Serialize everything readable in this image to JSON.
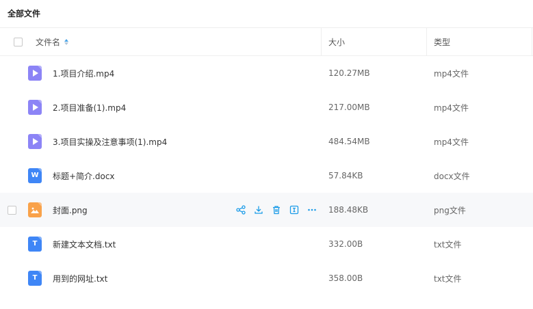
{
  "page": {
    "title": "全部文件"
  },
  "table": {
    "columns": {
      "name": "文件名",
      "size": "大小",
      "type": "类型"
    },
    "rows": [
      {
        "name": "1.项目介绍.mp4",
        "size": "120.27MB",
        "type": "mp4文件",
        "icon": "video-file-icon"
      },
      {
        "name": "2.项目准备(1).mp4",
        "size": "217.00MB",
        "type": "mp4文件",
        "icon": "video-file-icon"
      },
      {
        "name": "3.项目实操及注意事项(1).mp4",
        "size": "484.54MB",
        "type": "mp4文件",
        "icon": "video-file-icon"
      },
      {
        "name": "标题+简介.docx",
        "size": "57.84KB",
        "type": "docx文件",
        "icon": "word-file-icon"
      },
      {
        "name": "封面.png",
        "size": "188.48KB",
        "type": "png文件",
        "icon": "image-file-icon"
      },
      {
        "name": "新建文本文档.txt",
        "size": "332.00B",
        "type": "txt文件",
        "icon": "text-file-icon"
      },
      {
        "name": "用到的网址.txt",
        "size": "358.00B",
        "type": "txt文件",
        "icon": "text-file-icon"
      }
    ]
  },
  "row_actions": [
    "share-icon",
    "download-icon",
    "delete-icon",
    "rename-icon",
    "more-icon"
  ],
  "colors": {
    "accent": "#1a9be8",
    "video": "#8c84f6",
    "word": "#3f86f6",
    "image": "#f9a24a",
    "hover_row": "#f7f8fa"
  }
}
